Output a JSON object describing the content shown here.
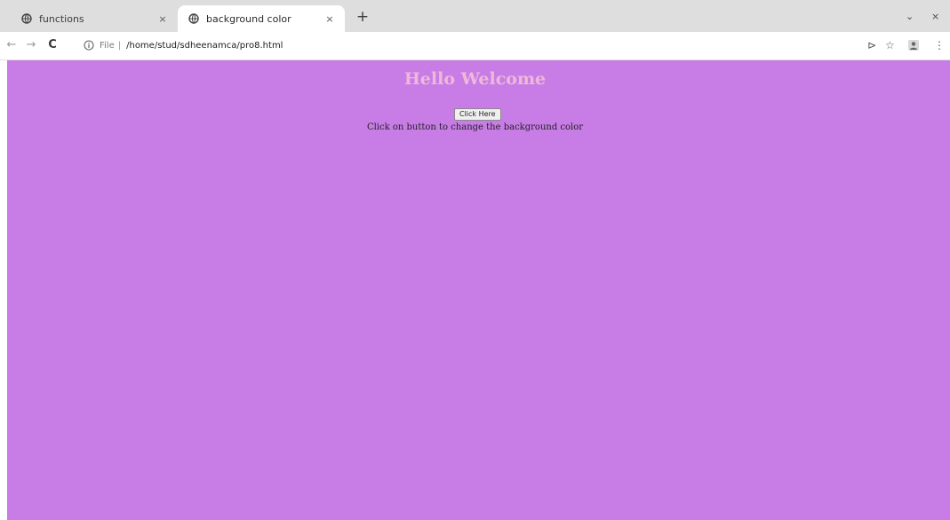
{
  "browser": {
    "tabs": [
      {
        "title": "functions",
        "active": false,
        "close_symbol": "×"
      },
      {
        "title": "background color",
        "active": true,
        "close_symbol": "×"
      }
    ],
    "new_tab_symbol": "+",
    "window_controls": {
      "dropdown": "⌄",
      "close": "×"
    },
    "toolbar": {
      "back_symbol": "←",
      "forward_symbol": "→",
      "reload_symbol": "C",
      "omnibox": {
        "scheme_label": "File",
        "separator": "|",
        "url": "/home/stud/sdheenamca/pro8.html"
      },
      "icons": {
        "cast": "⊳",
        "bookmark": "☆",
        "menu": "⋮"
      }
    }
  },
  "page": {
    "background_color": "#c87ce6",
    "heading": "Hello Welcome",
    "heading_color": "#f0b8d8",
    "button_label": "Click Here",
    "description": "Click on button to change the background color"
  }
}
